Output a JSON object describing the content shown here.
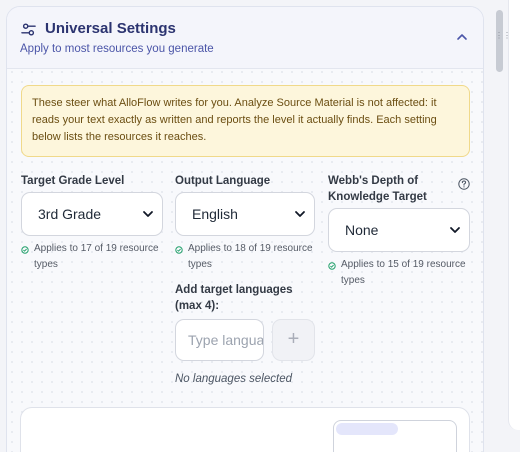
{
  "header": {
    "title": "Universal Settings",
    "subtitle": "Apply to most resources you generate"
  },
  "note": {
    "text": "These steer what AlloFlow writes for you. Analyze Source Material is not affected: it reads your text exactly as written and reports the level it actually finds. Each setting below lists the resources it reaches."
  },
  "grade": {
    "label": "Target Grade Level",
    "value": "3rd Grade",
    "applies": "Applies to 17 of 19 resource types"
  },
  "language": {
    "label": "Output Language",
    "value": "English",
    "applies": "Applies to 18 of 19 resource types",
    "add_label": "Add target languages (max 4):",
    "input_placeholder": "Type language",
    "add_button": "+",
    "empty_text": "No languages selected"
  },
  "dok": {
    "label": "Webb's Depth of Knowledge Target",
    "value": "None",
    "applies": "Applies to 15 of 19 resource types"
  },
  "icons": {
    "header": "sliders-icon",
    "collapse": "chevron-up-icon",
    "help": "question-circle-icon",
    "applies": "check-circle-icon",
    "caret": "chevron-down-icon",
    "grip": "drag-handle-icon"
  },
  "colors": {
    "title": "#2c3470",
    "subtitle": "#4b55a8",
    "note_bg": "#fdf6dc",
    "note_border": "#f0d98a",
    "applies_icon": "#22a06b"
  }
}
